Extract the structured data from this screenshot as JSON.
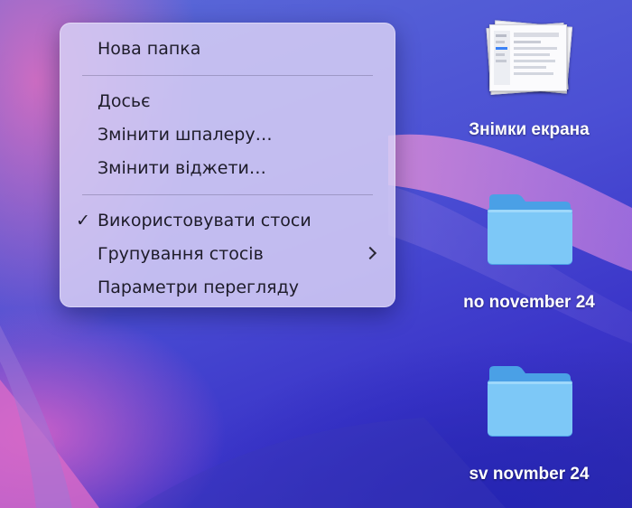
{
  "context_menu": {
    "items": [
      {
        "label": "Нова папка",
        "checked": false,
        "submenu": false
      },
      {
        "label": "Досьє",
        "checked": false,
        "submenu": false
      },
      {
        "label": "Змінити шпалеру…",
        "checked": false,
        "submenu": false
      },
      {
        "label": "Змінити віджети…",
        "checked": false,
        "submenu": false
      },
      {
        "label": "Використовувати стоси",
        "checked": true,
        "submenu": false
      },
      {
        "label": "Групування стосів",
        "checked": false,
        "submenu": true
      },
      {
        "label": "Параметри перегляду",
        "checked": false,
        "submenu": false
      }
    ],
    "check_glyph": "✓"
  },
  "desktop": {
    "items": [
      {
        "label": "Знімки екрана",
        "icon": "screenshot-stack-icon"
      },
      {
        "label": "no november 24",
        "icon": "folder-icon"
      },
      {
        "label": "sv novmber 24",
        "icon": "folder-icon"
      }
    ]
  },
  "colors": {
    "folder_light": "#7dc8f7",
    "folder_dark": "#4aa0e6",
    "menu_text": "#1e1c2a"
  }
}
